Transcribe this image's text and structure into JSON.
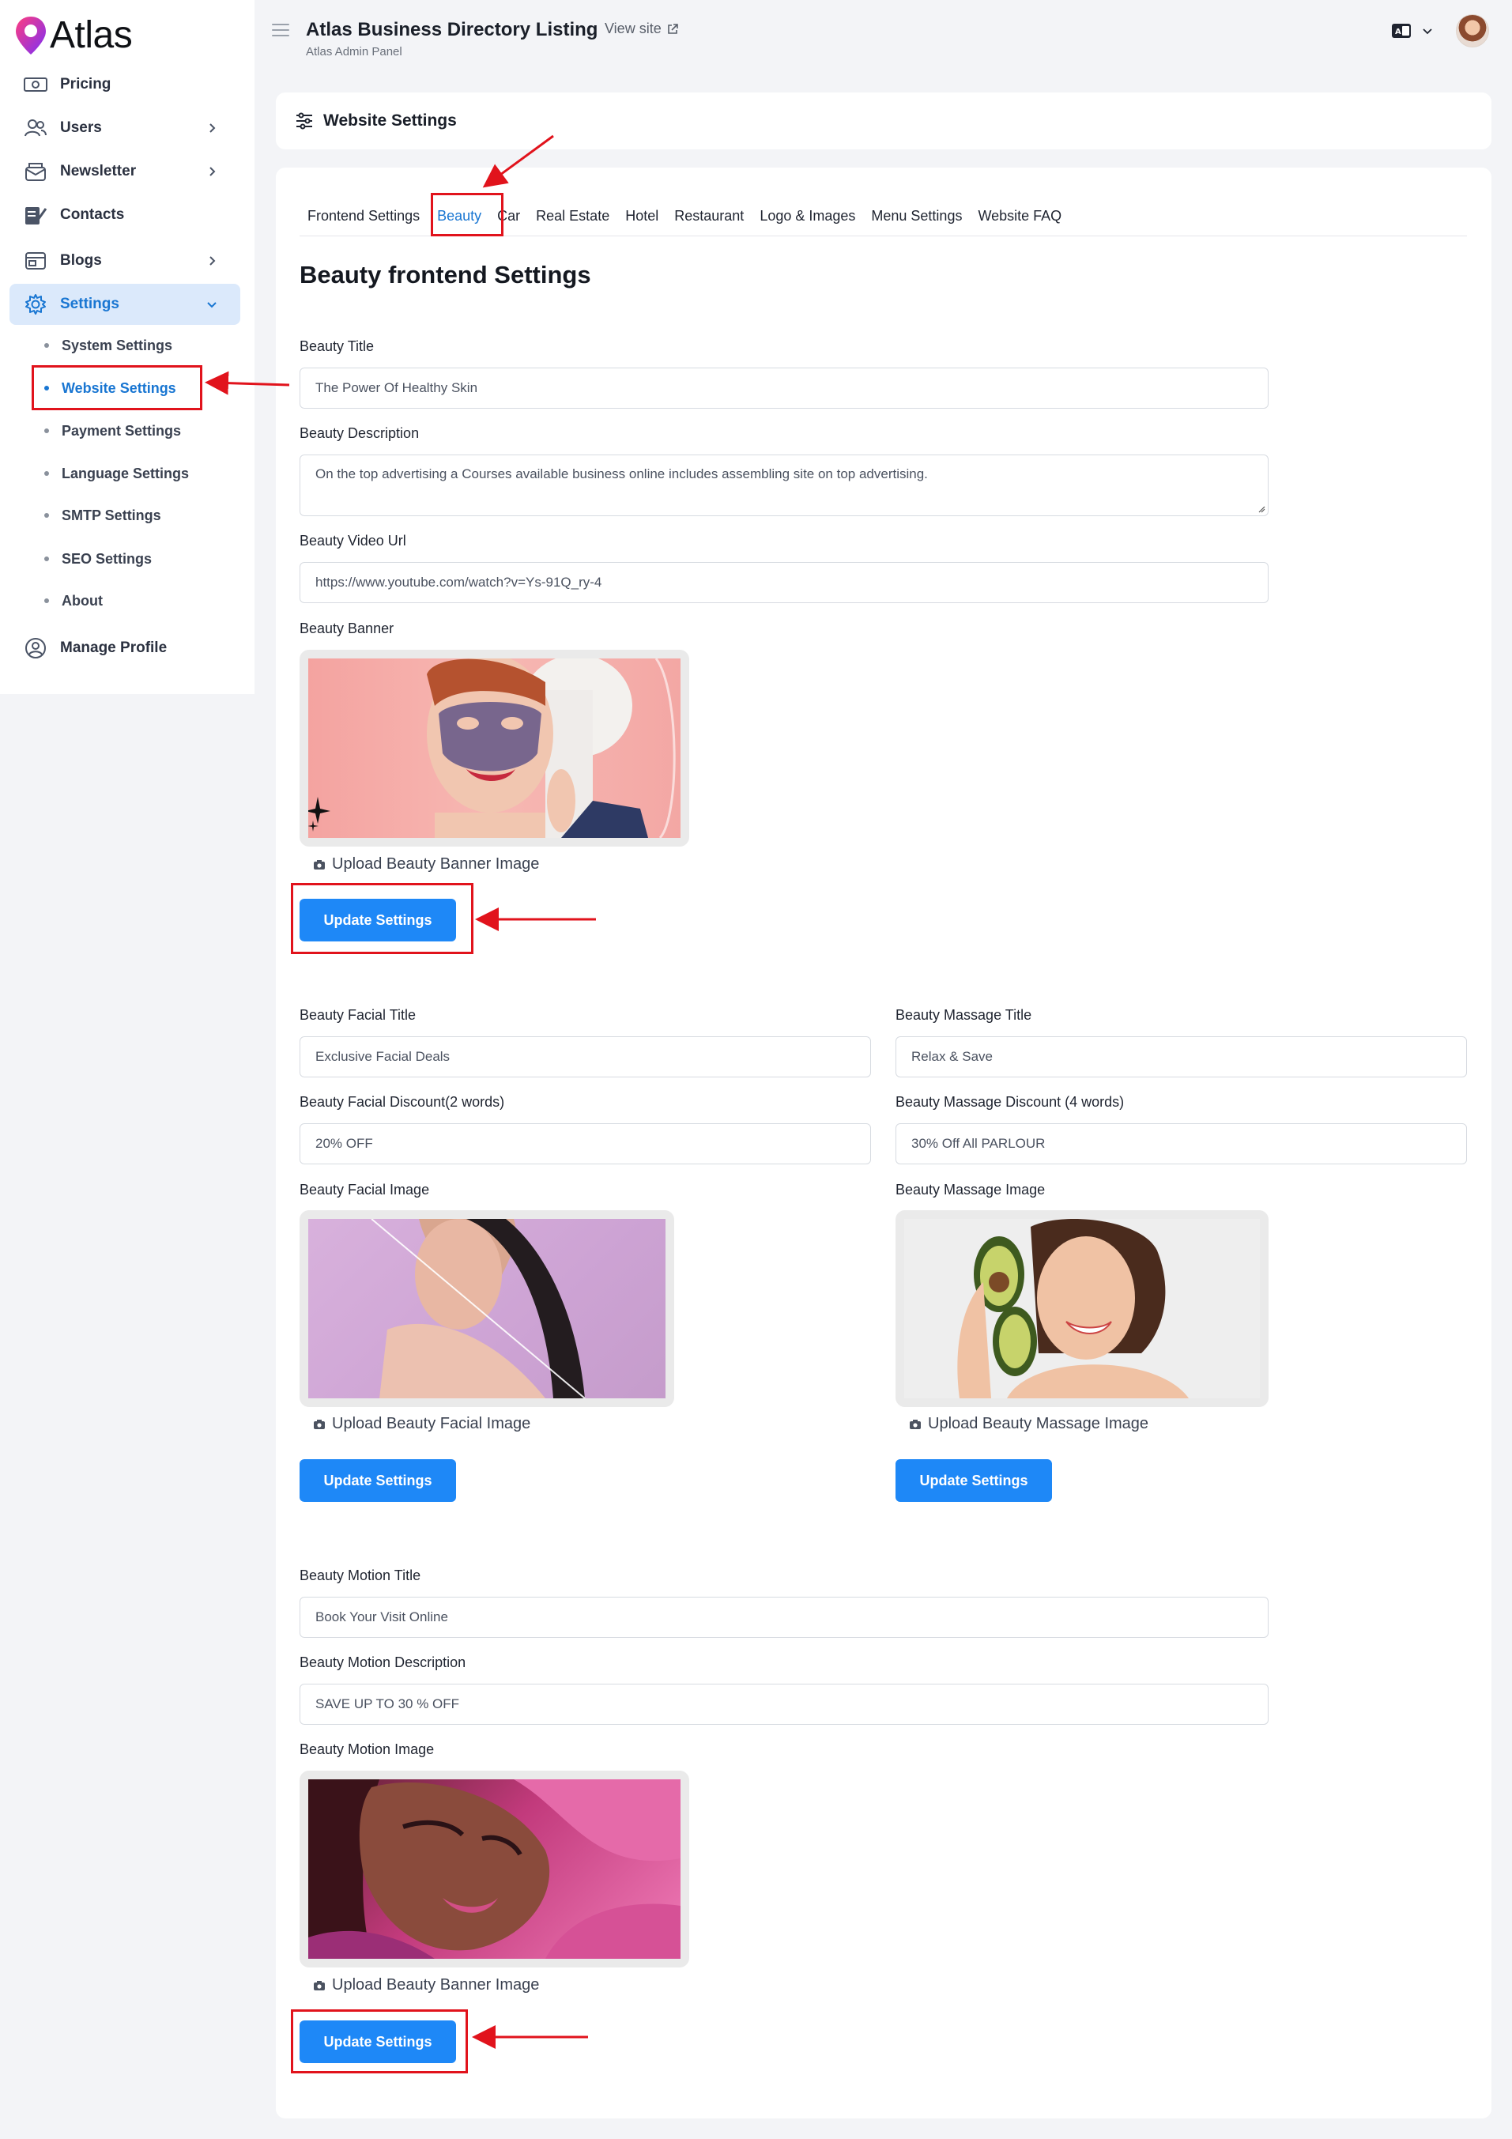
{
  "brand": {
    "name": "Atlas"
  },
  "sidebar": {
    "items": [
      {
        "label": "Pricing",
        "icon": "pricing-icon"
      },
      {
        "label": "Users",
        "icon": "users-icon"
      },
      {
        "label": "Newsletter",
        "icon": "newsletter-icon"
      },
      {
        "label": "Contacts",
        "icon": "contacts-icon"
      },
      {
        "label": "Blogs",
        "icon": "blogs-icon"
      },
      {
        "label": "Settings",
        "icon": "gear-icon"
      },
      {
        "label": "Manage Profile",
        "icon": "profile-icon"
      }
    ],
    "settings_sub": [
      {
        "label": "System Settings"
      },
      {
        "label": "Website Settings"
      },
      {
        "label": "Payment Settings"
      },
      {
        "label": "Language Settings"
      },
      {
        "label": "SMTP Settings"
      },
      {
        "label": "SEO Settings"
      },
      {
        "label": "About"
      }
    ]
  },
  "header": {
    "title": "Atlas Business Directory Listing",
    "subtitle": "Atlas Admin Panel",
    "view_site": "View site"
  },
  "page": {
    "card_title": "Website Settings",
    "tabs": [
      {
        "label": "Frontend Settings"
      },
      {
        "label": "Beauty"
      },
      {
        "label": "Car"
      },
      {
        "label": "Real Estate"
      },
      {
        "label": "Hotel"
      },
      {
        "label": "Restaurant"
      },
      {
        "label": "Logo & Images"
      },
      {
        "label": "Menu Settings"
      },
      {
        "label": "Website FAQ"
      }
    ],
    "active_tab": "Beauty",
    "section_title": "Beauty frontend Settings"
  },
  "form": {
    "beauty_title": {
      "label": "Beauty Title",
      "value": "The Power Of Healthy Skin"
    },
    "beauty_description": {
      "label": "Beauty Description",
      "value": "On the top advertising a Courses available business online includes assembling site on top advertising."
    },
    "beauty_video_url": {
      "label": "Beauty Video Url",
      "value": "https://www.youtube.com/watch?v=Ys-91Q_ry-4"
    },
    "beauty_banner": {
      "label": "Beauty Banner",
      "upload": "Upload Beauty Banner Image"
    },
    "facial_title": {
      "label": "Beauty Facial Title",
      "value": "Exclusive Facial Deals"
    },
    "massage_title": {
      "label": "Beauty Massage Title",
      "value": "Relax & Save"
    },
    "facial_discount": {
      "label": "Beauty Facial Discount(2 words)",
      "value": "20% OFF"
    },
    "massage_discount": {
      "label": "Beauty Massage Discount (4 words)",
      "value": "30% Off All PARLOUR"
    },
    "facial_image": {
      "label": "Beauty Facial Image",
      "upload": "Upload Beauty Facial Image"
    },
    "massage_image": {
      "label": "Beauty Massage Image",
      "upload": "Upload Beauty Massage Image"
    },
    "motion_title": {
      "label": "Beauty Motion Title",
      "value": "Book Your Visit Online"
    },
    "motion_description": {
      "label": "Beauty Motion Description",
      "value": "SAVE UP TO 30 % OFF"
    },
    "motion_image": {
      "label": "Beauty Motion Image",
      "upload": "Upload Beauty Banner Image"
    },
    "update_button": "Update Settings"
  },
  "colors": {
    "accent": "#1e88f7",
    "active_nav_bg": "#dbe9fb",
    "annotation": "#e1131c"
  }
}
